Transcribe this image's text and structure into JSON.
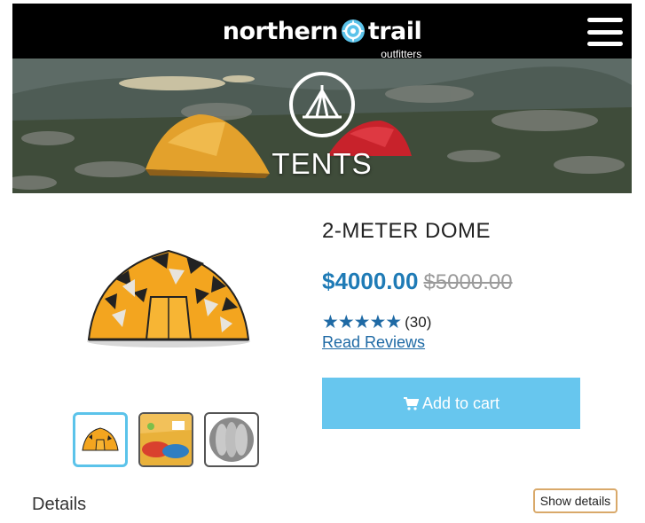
{
  "header": {
    "brand_left": "northern",
    "brand_right": "trail",
    "brand_sub": "outfitters",
    "menu_icon": "hamburger-menu-icon"
  },
  "hero": {
    "title": "TENTS",
    "icon": "tent-icon"
  },
  "product": {
    "name": "2-METER DOME",
    "price": "$4000.00",
    "original_price": "$5000.00",
    "rating": 5,
    "stars": "★★★★★",
    "review_count": "(30)",
    "reviews_link": "Read Reviews",
    "add_to_cart_label": "Add to cart",
    "cart_icon": "cart-icon",
    "accent_color": "#1f7bb6",
    "cart_button_color": "#67c6ee"
  },
  "thumbnails": [
    {
      "name": "tent-front",
      "active": true
    },
    {
      "name": "tent-interior",
      "active": false
    },
    {
      "name": "tent-top",
      "active": false
    }
  ],
  "details": {
    "heading": "Details",
    "toggle_label": "Show details"
  }
}
